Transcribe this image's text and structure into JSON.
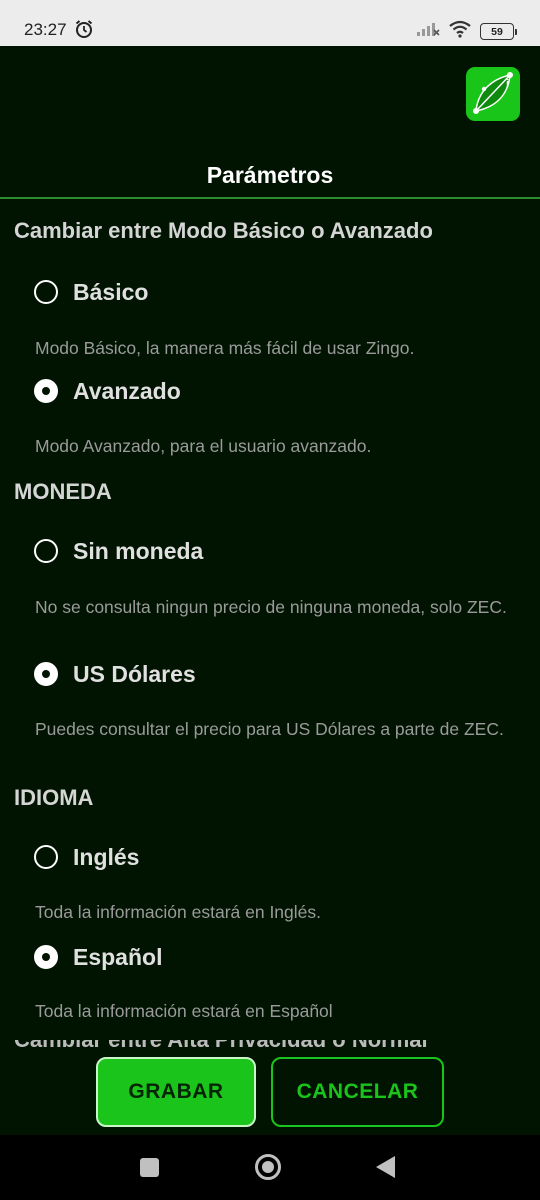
{
  "status_bar": {
    "time": "23:27",
    "battery": "59",
    "icons": [
      "alarm-icon",
      "signal-icon",
      "wifi-icon",
      "battery-icon"
    ]
  },
  "header": {
    "title": "Parámetros",
    "logo_icon": "zingo-logo-icon"
  },
  "sections": {
    "mode": {
      "title": "Cambiar entre Modo Básico o Avanzado",
      "options": [
        {
          "label": "Básico",
          "description": "Modo Básico, la manera más fácil de usar Zingo.",
          "selected": false
        },
        {
          "label": "Avanzado",
          "description": "Modo Avanzado, para el usuario avanzado.",
          "selected": true
        }
      ]
    },
    "currency": {
      "title": "MONEDA",
      "options": [
        {
          "label": "Sin moneda",
          "description": "No se consulta ningun precio de ninguna moneda, solo ZEC.",
          "selected": false
        },
        {
          "label": "US Dólares",
          "description": "Puedes consultar el precio para US Dólares a parte de ZEC.",
          "selected": true
        }
      ]
    },
    "language": {
      "title": "IDIOMA",
      "options": [
        {
          "label": "Inglés",
          "description": "Toda la información estará en Inglés.",
          "selected": false
        },
        {
          "label": "Español",
          "description": "Toda la información estará en Español",
          "selected": true
        }
      ]
    },
    "next_partial": "Cambiar entre Alta Privacidad o Normal"
  },
  "buttons": {
    "save": "GRABAR",
    "cancel": "CANCELAR"
  },
  "navbar": {
    "icons": [
      "recents-square-icon",
      "home-circle-icon",
      "back-triangle-icon"
    ]
  },
  "colors": {
    "background": "#011401",
    "accent": "#1ac41a",
    "divider": "#2e8b2e"
  }
}
